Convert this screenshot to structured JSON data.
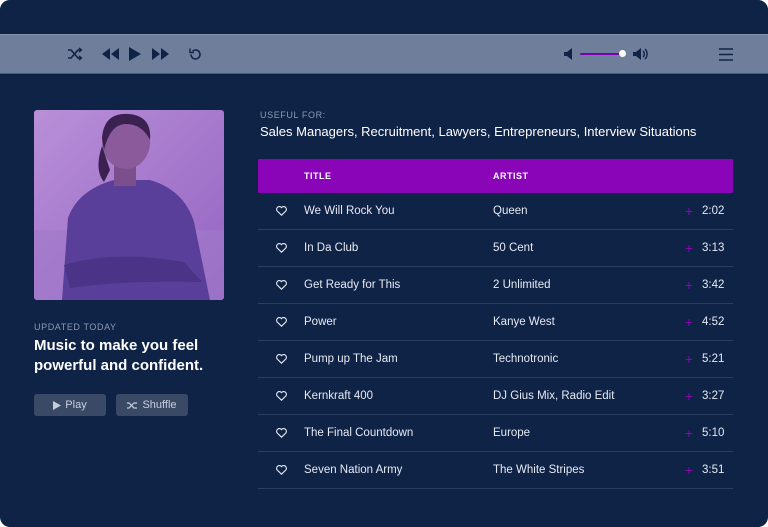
{
  "player": {
    "controls": [
      "shuffle-icon",
      "rewind-icon",
      "play-icon",
      "fast-forward-icon",
      "repeat-icon"
    ],
    "volume": {
      "level": 0.85,
      "accent_color": "#7a00b4"
    },
    "menu_icon": "hamburger-menu-icon"
  },
  "album": {
    "updated_label": "UPDATED TODAY",
    "headline": "Music to make you feel powerful and confident.",
    "play_label": "Play",
    "shuffle_label": "Shuffle"
  },
  "useful_for": {
    "label": "USEFUL FOR:",
    "text": "Sales Managers, Recruitment, Lawyers, Entrepreneurs, Interview Situations"
  },
  "table": {
    "header_color": "#8a05b8",
    "columns": {
      "title": "TITLE",
      "artist": "ARTIST"
    },
    "rows": [
      {
        "title": "We Will Rock You",
        "artist": "Queen",
        "duration": "2:02"
      },
      {
        "title": "In Da Club",
        "artist": "50 Cent",
        "duration": "3:13"
      },
      {
        "title": "Get Ready for This",
        "artist": "2 Unlimited",
        "duration": "3:42"
      },
      {
        "title": "Power",
        "artist": "Kanye West",
        "duration": "4:52"
      },
      {
        "title": "Pump up The Jam",
        "artist": "Technotronic",
        "duration": "5:21"
      },
      {
        "title": "Kernkraft 400",
        "artist": "DJ Gius Mix, Radio Edit",
        "duration": "3:27"
      },
      {
        "title": "The Final Countdown",
        "artist": "Europe",
        "duration": "5:10"
      },
      {
        "title": "Seven Nation Army",
        "artist": "The White Stripes",
        "duration": "3:51"
      }
    ]
  }
}
